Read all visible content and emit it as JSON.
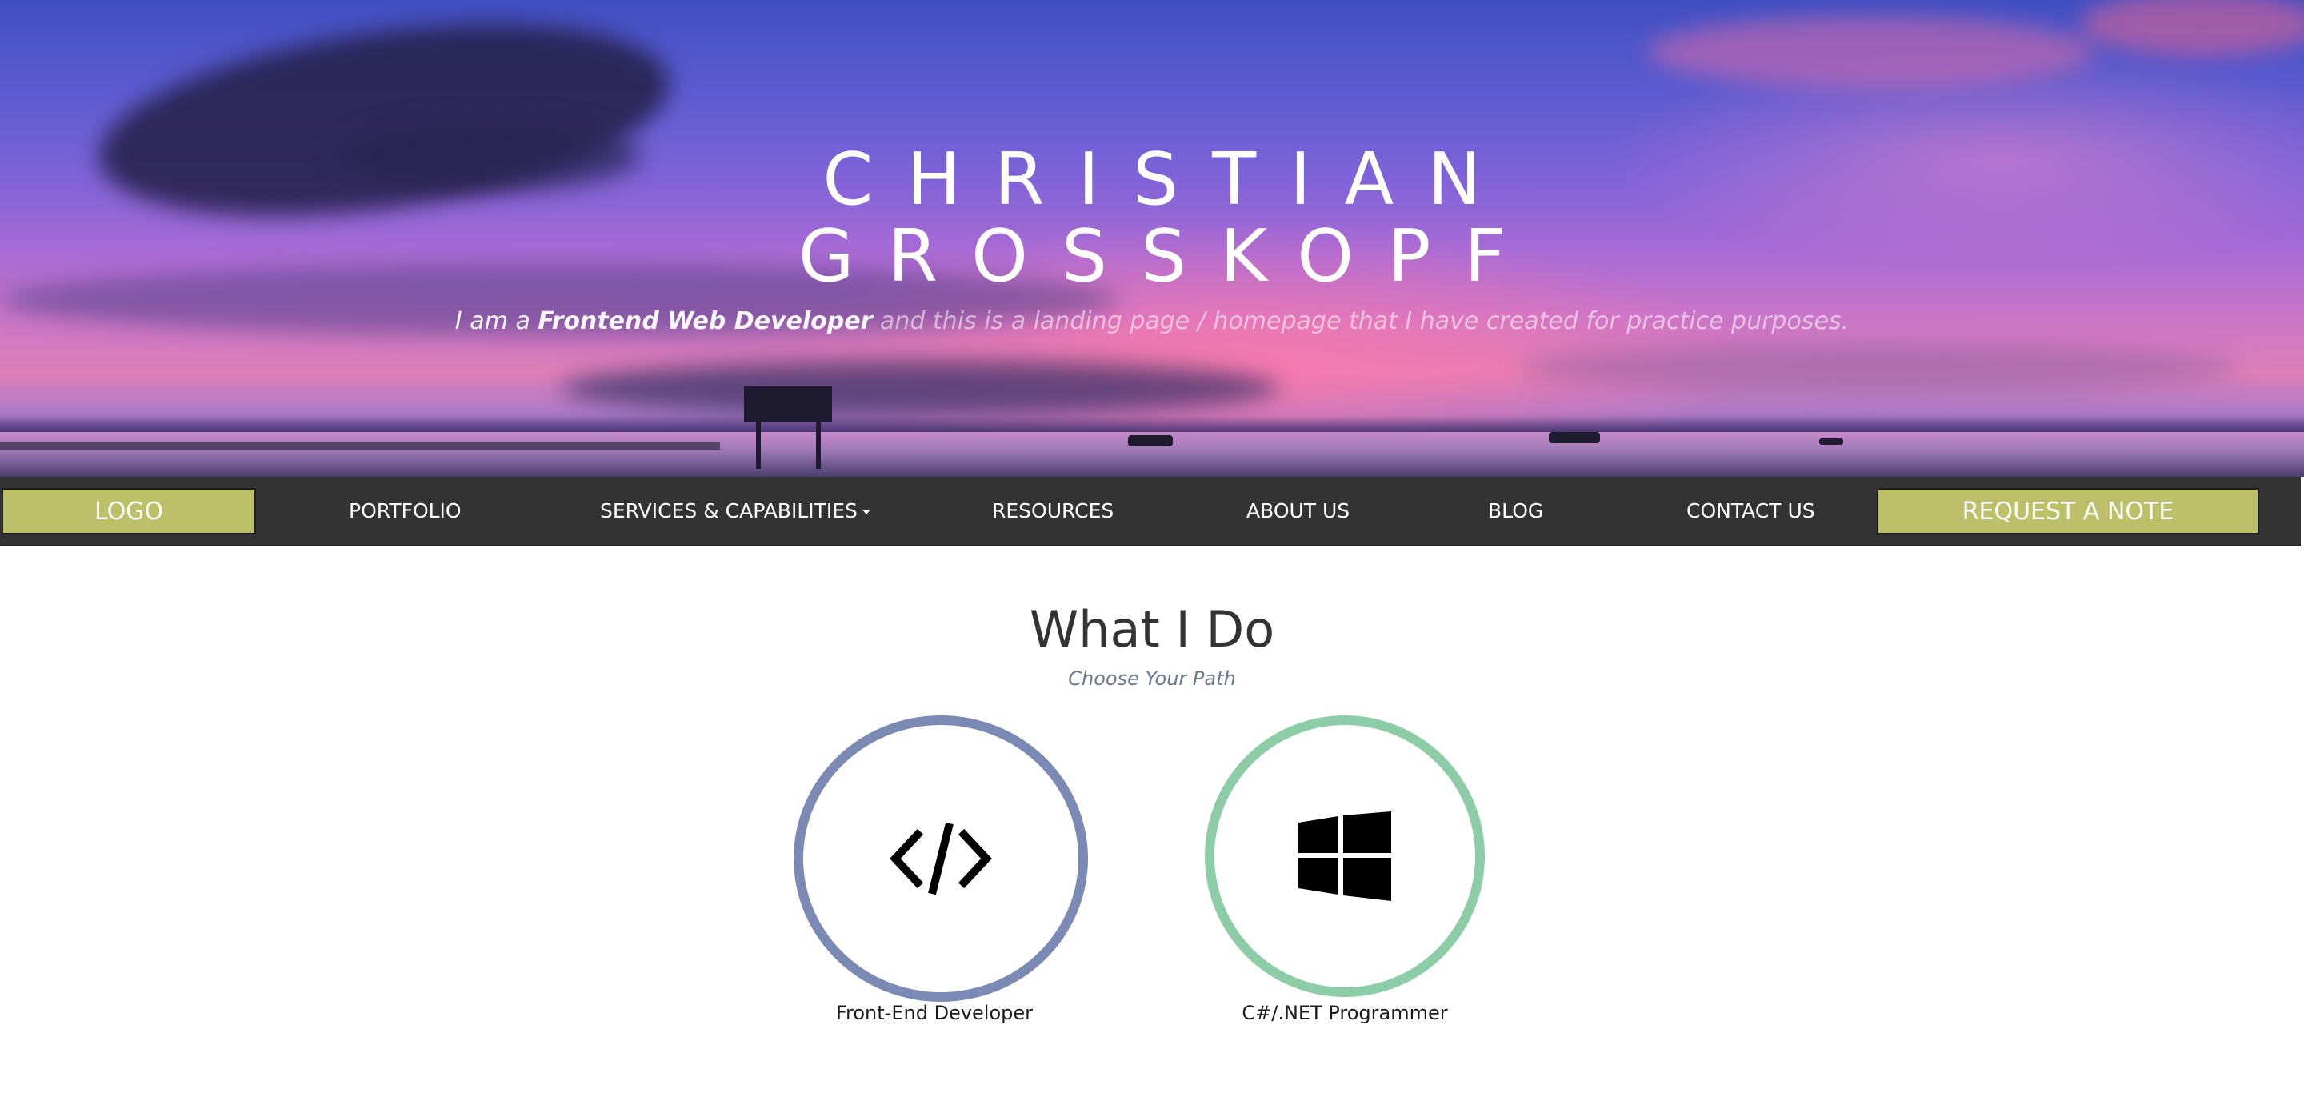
{
  "hero": {
    "name_line1": "CHRISTIAN",
    "name_line2": "GROSSKOPF",
    "tagline_intro": "I am a ",
    "tagline_highlight": "Frontend Web Developer",
    "tagline_rest": " and this is a landing page / homepage that I have created for practice purposes."
  },
  "nav": {
    "logo_label": "LOGO",
    "items": [
      {
        "label": "PORTFOLIO"
      },
      {
        "label": "SERVICES & CAPABILITIES"
      },
      {
        "label": "RESOURCES"
      },
      {
        "label": "ABOUT US"
      },
      {
        "label": "BLOG"
      },
      {
        "label": "CONTACT US"
      }
    ],
    "cta_label": "REQUEST A NOTE"
  },
  "what_i_do": {
    "title": "What I Do",
    "subtitle": "Choose Your Path",
    "paths": [
      {
        "label": "Front-End Developer",
        "icon": "code-icon",
        "ring_color": "#7b8ab4"
      },
      {
        "label": "C#/.NET Programmer",
        "icon": "windows-icon",
        "ring_color": "#8ccca6"
      }
    ]
  },
  "colors": {
    "nav_background": "#333333",
    "button_accent": "#bcc069"
  }
}
